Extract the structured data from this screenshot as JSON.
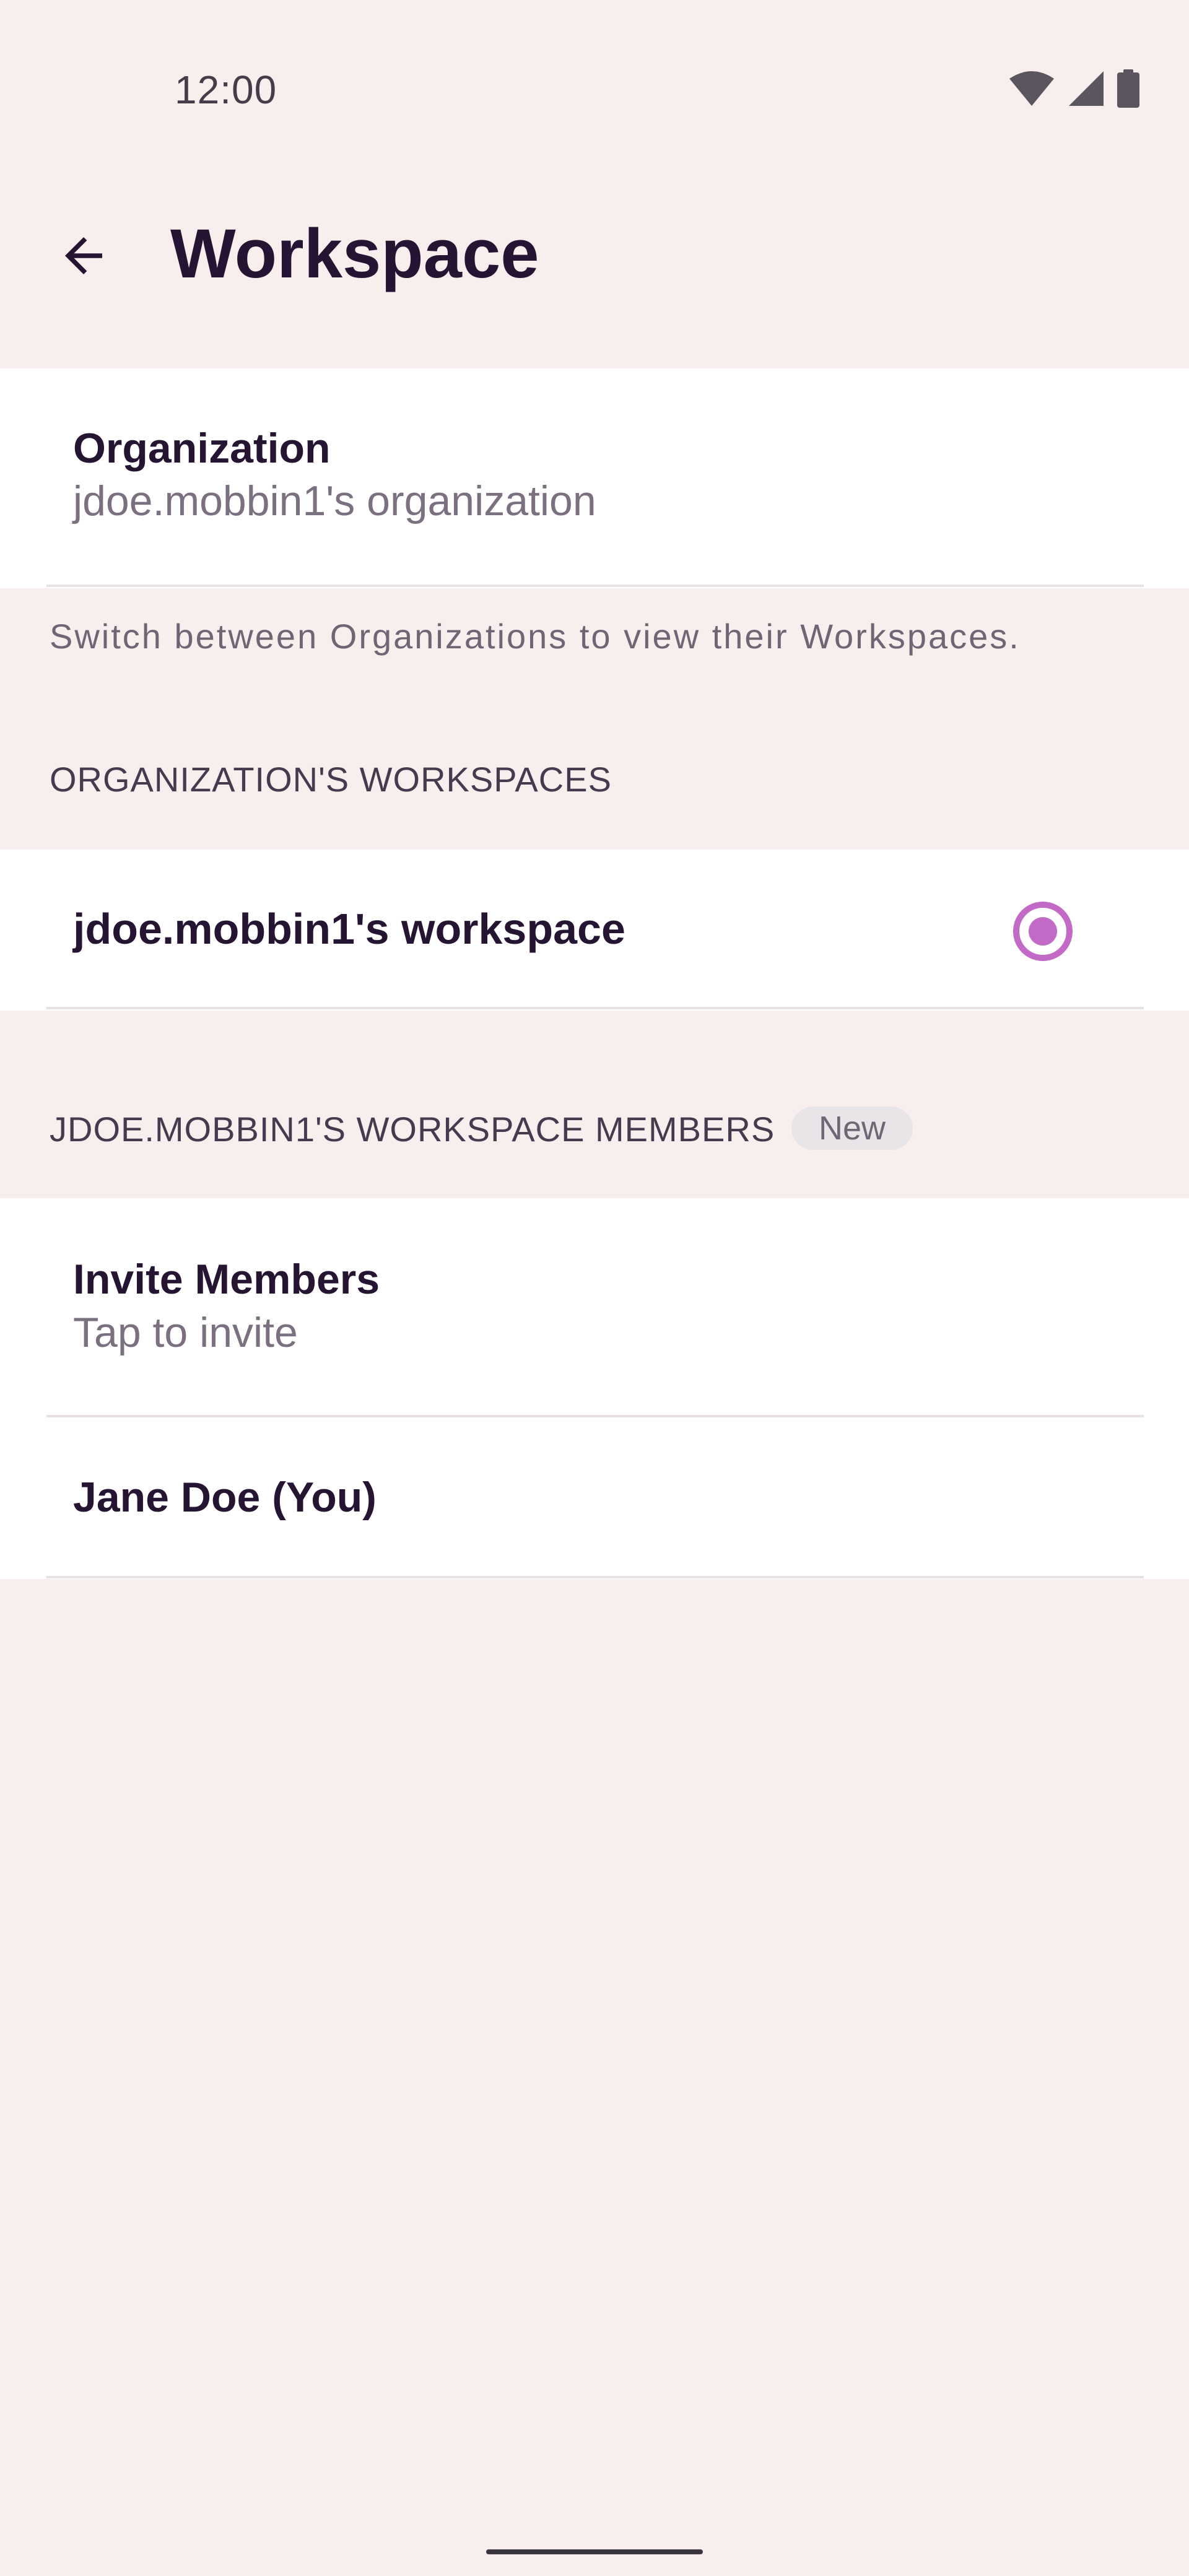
{
  "status_bar": {
    "time": "12:00",
    "icons": [
      "wifi-icon",
      "signal-icon",
      "battery-icon"
    ]
  },
  "app_bar": {
    "title": "Workspace",
    "back_icon": "arrow-back-icon"
  },
  "organization": {
    "title": "Organization",
    "value": "jdoe.mobbin1's organization",
    "caption": "Switch between Organizations to view their Workspaces."
  },
  "workspaces_section": {
    "header": "ORGANIZATION'S WORKSPACES",
    "items": [
      {
        "label": "jdoe.mobbin1's workspace",
        "selected": true
      }
    ]
  },
  "members_section": {
    "header": "JDOE.MOBBIN1'S WORKSPACE MEMBERS",
    "badge": "New",
    "invite": {
      "title": "Invite Members",
      "subtitle": "Tap to invite"
    },
    "members": [
      {
        "name": "Jane Doe (You)"
      }
    ]
  },
  "colors": {
    "background": "#F8EEEE",
    "surface": "#FFFFFF",
    "accent": "#C36AC6",
    "text_primary": "#261433",
    "text_secondary": "#7A7080"
  }
}
